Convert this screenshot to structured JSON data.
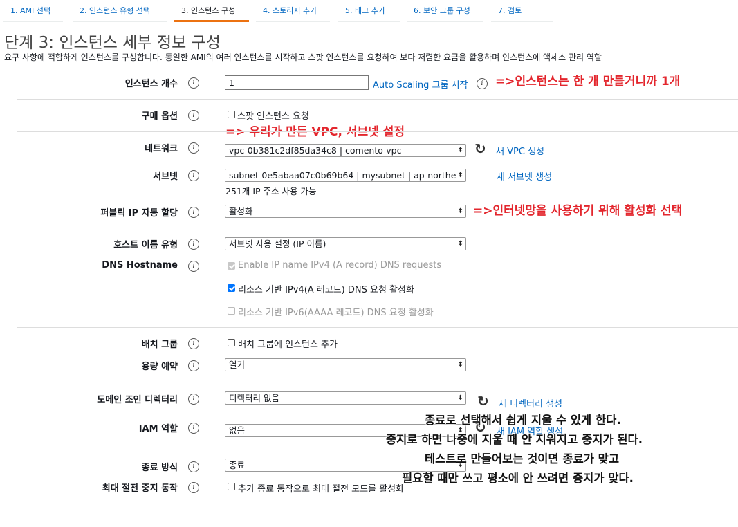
{
  "tabs": [
    {
      "label": "1. AMI 선택"
    },
    {
      "label": "2. 인스턴스 유형 선택"
    },
    {
      "label": "3. 인스턴스 구성"
    },
    {
      "label": "4. 스토리지 추가"
    },
    {
      "label": "5. 태그 추가"
    },
    {
      "label": "6. 보안 그룹 구성"
    },
    {
      "label": "7. 검토"
    }
  ],
  "page": {
    "title": "단계 3: 인스턴스 세부 정보 구성",
    "description": "요구 사항에 적합하게 인스턴스를 구성합니다. 동일한 AMI의 여러 인스턴스를 시작하고 스팟 인스턴스를 요청하여 보다 저렴한 요금을 활용하며 인스턴스에 액세스 관리 역할"
  },
  "fields": {
    "instance_count": {
      "label": "인스턴스 개수",
      "value": "1",
      "link": "Auto Scaling 그룹 시작"
    },
    "purchase_option": {
      "label": "구매 옵션",
      "checkbox": "스팟 인스턴스 요청"
    },
    "network": {
      "label": "네트워크",
      "value": "vpc-0b381c2df85da34c8 | comento-vpc",
      "link": "새 VPC 생성"
    },
    "subnet": {
      "label": "서브넷",
      "value": "subnet-0e5abaa07c0b69b64 | mysubnet | ap-northe",
      "link": "새 서브넷 생성",
      "hint": "251개 IP 주소 사용 가능"
    },
    "public_ip": {
      "label": "퍼블릭 IP 자동 할당",
      "value": "활성화"
    },
    "hostname_type": {
      "label": "호스트 이름 유형",
      "value": "서브넷 사용 설정 (IP 이름)"
    },
    "dns_hostname": {
      "label": "DNS Hostname",
      "opt1": "Enable IP name IPv4 (A record) DNS requests",
      "opt2": "리소스 기반 IPv4(A 레코드) DNS 요청 활성화",
      "opt3": "리소스 기반 IPv6(AAAA 레코드) DNS 요청 활성화"
    },
    "placement_group": {
      "label": "배치 그룹",
      "checkbox": "배치 그룹에 인스턴스 추가"
    },
    "capacity_reservation": {
      "label": "용량 예약",
      "value": "열기"
    },
    "domain_join": {
      "label": "도메인 조인 디렉터리",
      "value": "디렉터리 없음",
      "link": "새 디렉터리 생성"
    },
    "iam_role": {
      "label": "IAM 역할",
      "value": "없음",
      "link": "새 IAM 역할 생성"
    },
    "shutdown_behavior": {
      "label": "종료 방식",
      "value": "종료"
    },
    "stop_hibernate": {
      "label": "최대 절전 중지 동작",
      "checkbox": "추가 종료 동작으로 최대 절전 모드를 활성화"
    }
  },
  "annotations": {
    "count_note": "=>인스턴스는 한 개 만들거니까 1개",
    "vpc_note": "=> 우리가 만든 VPC, 서브넷 설정",
    "ip_note": "=>인터넷망을 사용하기 위해 활성화 선택",
    "shutdown_note": [
      "종료로 선택해서 쉽게 지울 수 있게 한다.",
      "중지로 하면 나중에 지울 때 안 지워지고 중지가 된다.",
      "테스트로 만들어보는 것이면 종료가 맞고",
      "필요할 때만 쓰고 평소에 안 쓰려면 중지가 맞다."
    ]
  },
  "icons": {
    "info": "i",
    "refresh": "↻",
    "select_arrow": "⬍"
  }
}
